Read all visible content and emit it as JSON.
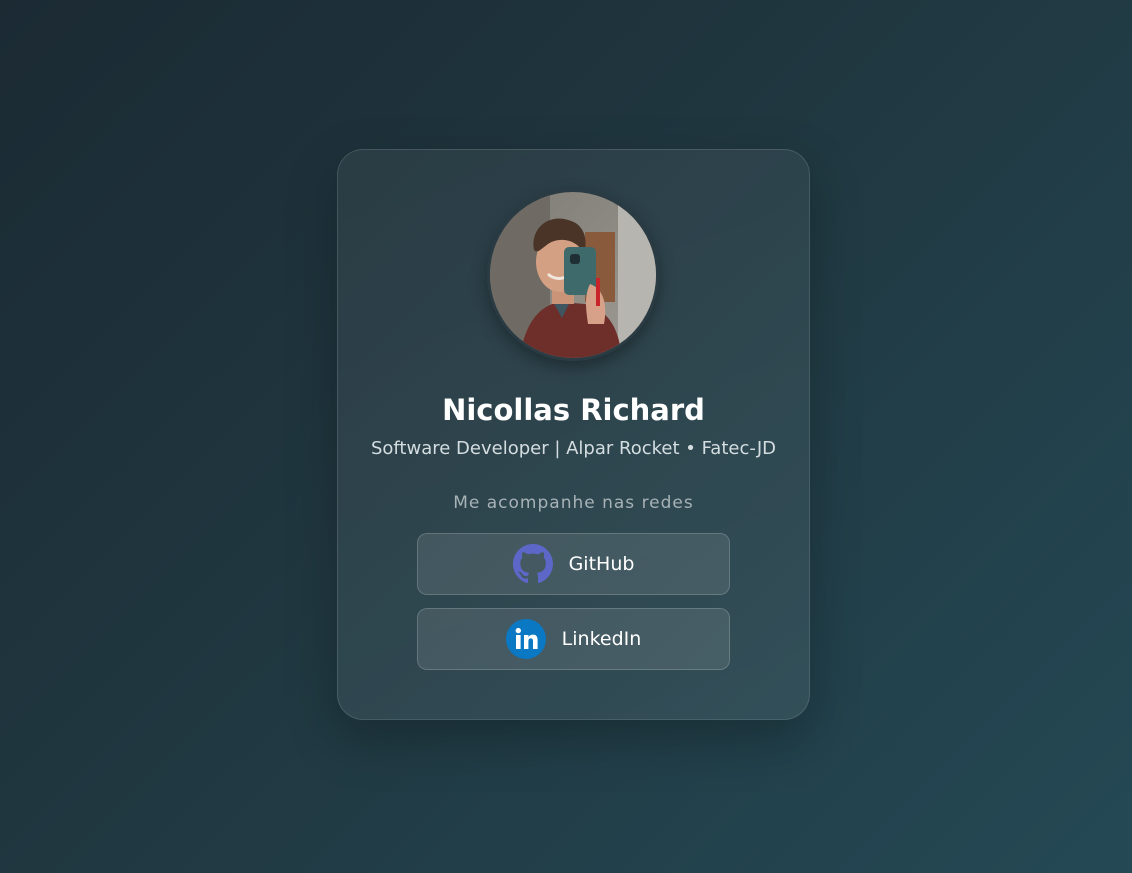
{
  "profile": {
    "name": "Nicollas Richard",
    "subtitle": "Software Developer | Alpar Rocket • Fatec-JD"
  },
  "social": {
    "heading": "Me acompanhe nas redes",
    "links": [
      {
        "label": "GitHub",
        "icon": "github-icon",
        "icon_color": "#5c67c8"
      },
      {
        "label": "LinkedIn",
        "icon": "linkedin-icon",
        "icon_color": "#0a78c2"
      }
    ]
  },
  "colors": {
    "background_start": "#1b2a33",
    "background_end": "#244955",
    "text_primary": "#ffffff",
    "text_muted": "#a7b2b6"
  }
}
